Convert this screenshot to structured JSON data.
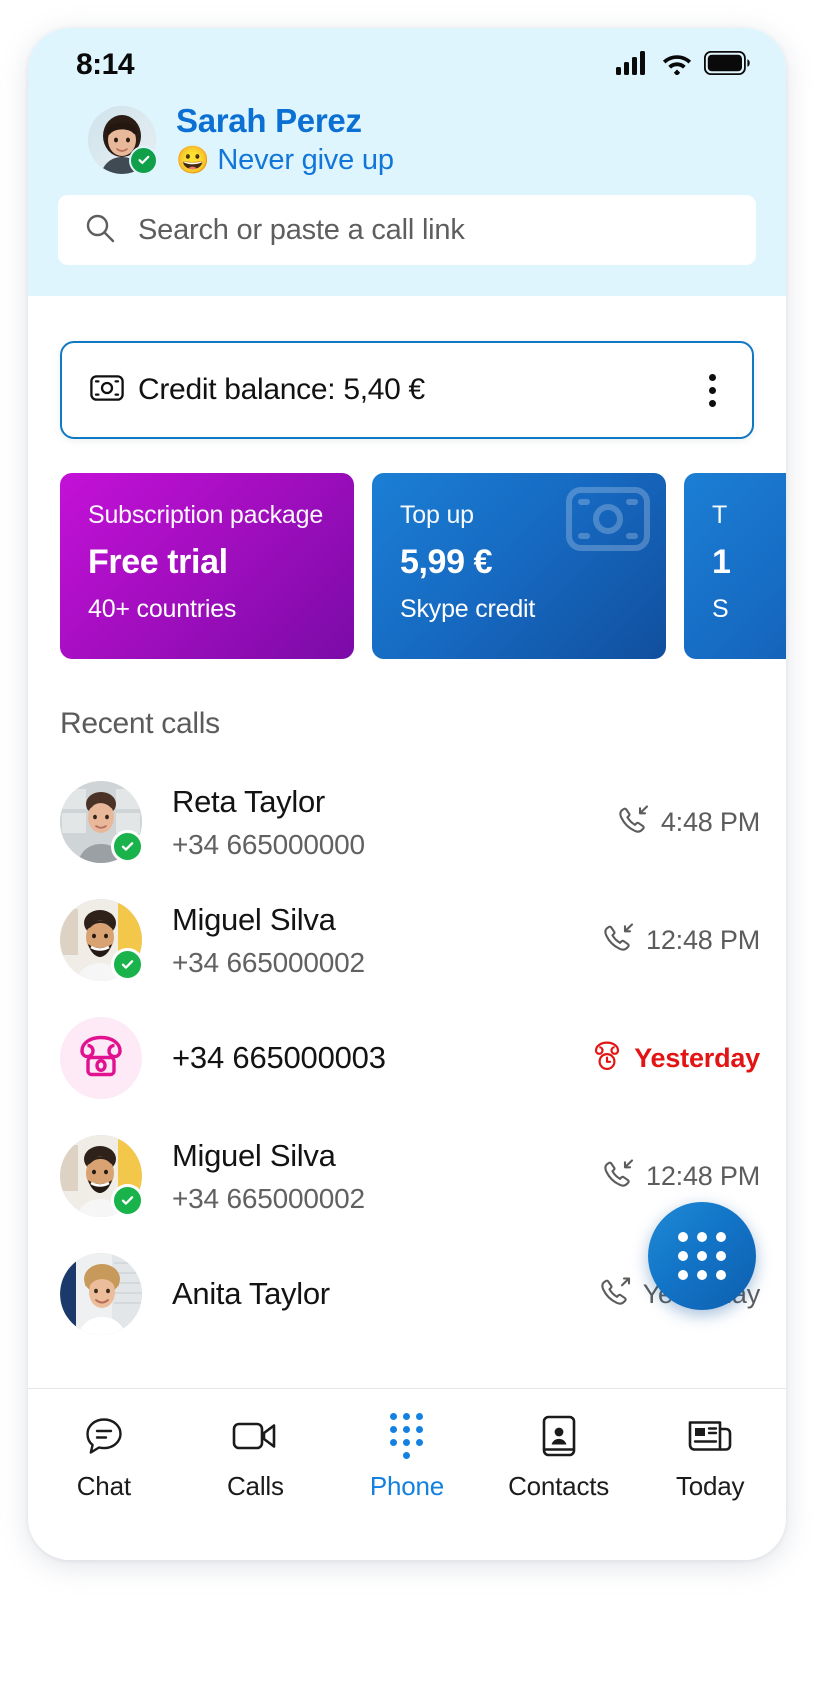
{
  "status_bar": {
    "time": "8:14",
    "icons": [
      "cellular-signal-icon",
      "wifi-icon",
      "battery-icon"
    ]
  },
  "profile": {
    "name": "Sarah Perez",
    "mood_emoji": "😀",
    "mood_text": "Never give up",
    "presence": "available",
    "avatar_name": "sarah-perez-avatar"
  },
  "search": {
    "placeholder": "Search or paste a call link",
    "icon": "search-icon"
  },
  "credit": {
    "icon": "banknote-icon",
    "label": "Credit balance: 5,40 €",
    "menu_icon": "more-vertical-icon"
  },
  "promos": [
    {
      "kicker": "Subscription package",
      "title": "Free trial",
      "sub": "40+ countries",
      "style": "purple",
      "bg_icon": ""
    },
    {
      "kicker": "Top up",
      "title": "5,99 €",
      "sub": "Skype credit",
      "style": "blue",
      "bg_icon": "banknote-icon"
    },
    {
      "kicker": "T",
      "title": "1",
      "sub": "S",
      "style": "blue",
      "bg_icon": ""
    }
  ],
  "recent": {
    "title": "Recent calls",
    "calls": [
      {
        "name": "Reta Taylor",
        "number": "+34 665000000",
        "time": "4:48 PM",
        "direction": "incoming",
        "direction_icon": "call-incoming-icon",
        "status": "answered",
        "avatar_name": "reta-taylor-avatar",
        "presence": "available"
      },
      {
        "name": "Miguel Silva",
        "number": "+34 665000002",
        "time": "12:48 PM",
        "direction": "incoming",
        "direction_icon": "call-incoming-icon",
        "status": "answered",
        "avatar_name": "miguel-silva-avatar",
        "presence": "available"
      },
      {
        "name": "",
        "number": "+34 665000003",
        "time": "Yesterday",
        "direction": "missed",
        "direction_icon": "missed-call-icon",
        "status": "missed",
        "avatar_name": "missed-call-avatar",
        "presence": "none"
      },
      {
        "name": "Miguel Silva",
        "number": "+34 665000002",
        "time": "12:48 PM",
        "direction": "incoming",
        "direction_icon": "call-incoming-icon",
        "status": "answered",
        "avatar_name": "miguel-silva-avatar",
        "presence": "available"
      },
      {
        "name": "Anita Taylor",
        "number": "",
        "time": "Yesterday",
        "direction": "outgoing",
        "direction_icon": "call-outgoing-icon",
        "status": "answered",
        "avatar_name": "anita-taylor-avatar",
        "presence": "none"
      }
    ]
  },
  "fab": {
    "name": "dialpad-fab",
    "icon": "dialpad-icon"
  },
  "bottom_nav": {
    "active": "Phone",
    "items": [
      {
        "label": "Chat",
        "icon": "chat-bubble-icon"
      },
      {
        "label": "Calls",
        "icon": "video-camera-icon"
      },
      {
        "label": "Phone",
        "icon": "dialpad-icon"
      },
      {
        "label": "Contacts",
        "icon": "contact-card-icon"
      },
      {
        "label": "Today",
        "icon": "news-feed-icon"
      }
    ]
  },
  "colors": {
    "header_bg": "#dff5fd",
    "brand_blue": "#0b6fd4",
    "accent_blue": "#1480e0",
    "promo_purple": "#a40ec0",
    "promo_blue": "#1668c0",
    "missed_red": "#e21414",
    "missed_pink": "#e0128f",
    "presence_green": "#19b24b"
  }
}
